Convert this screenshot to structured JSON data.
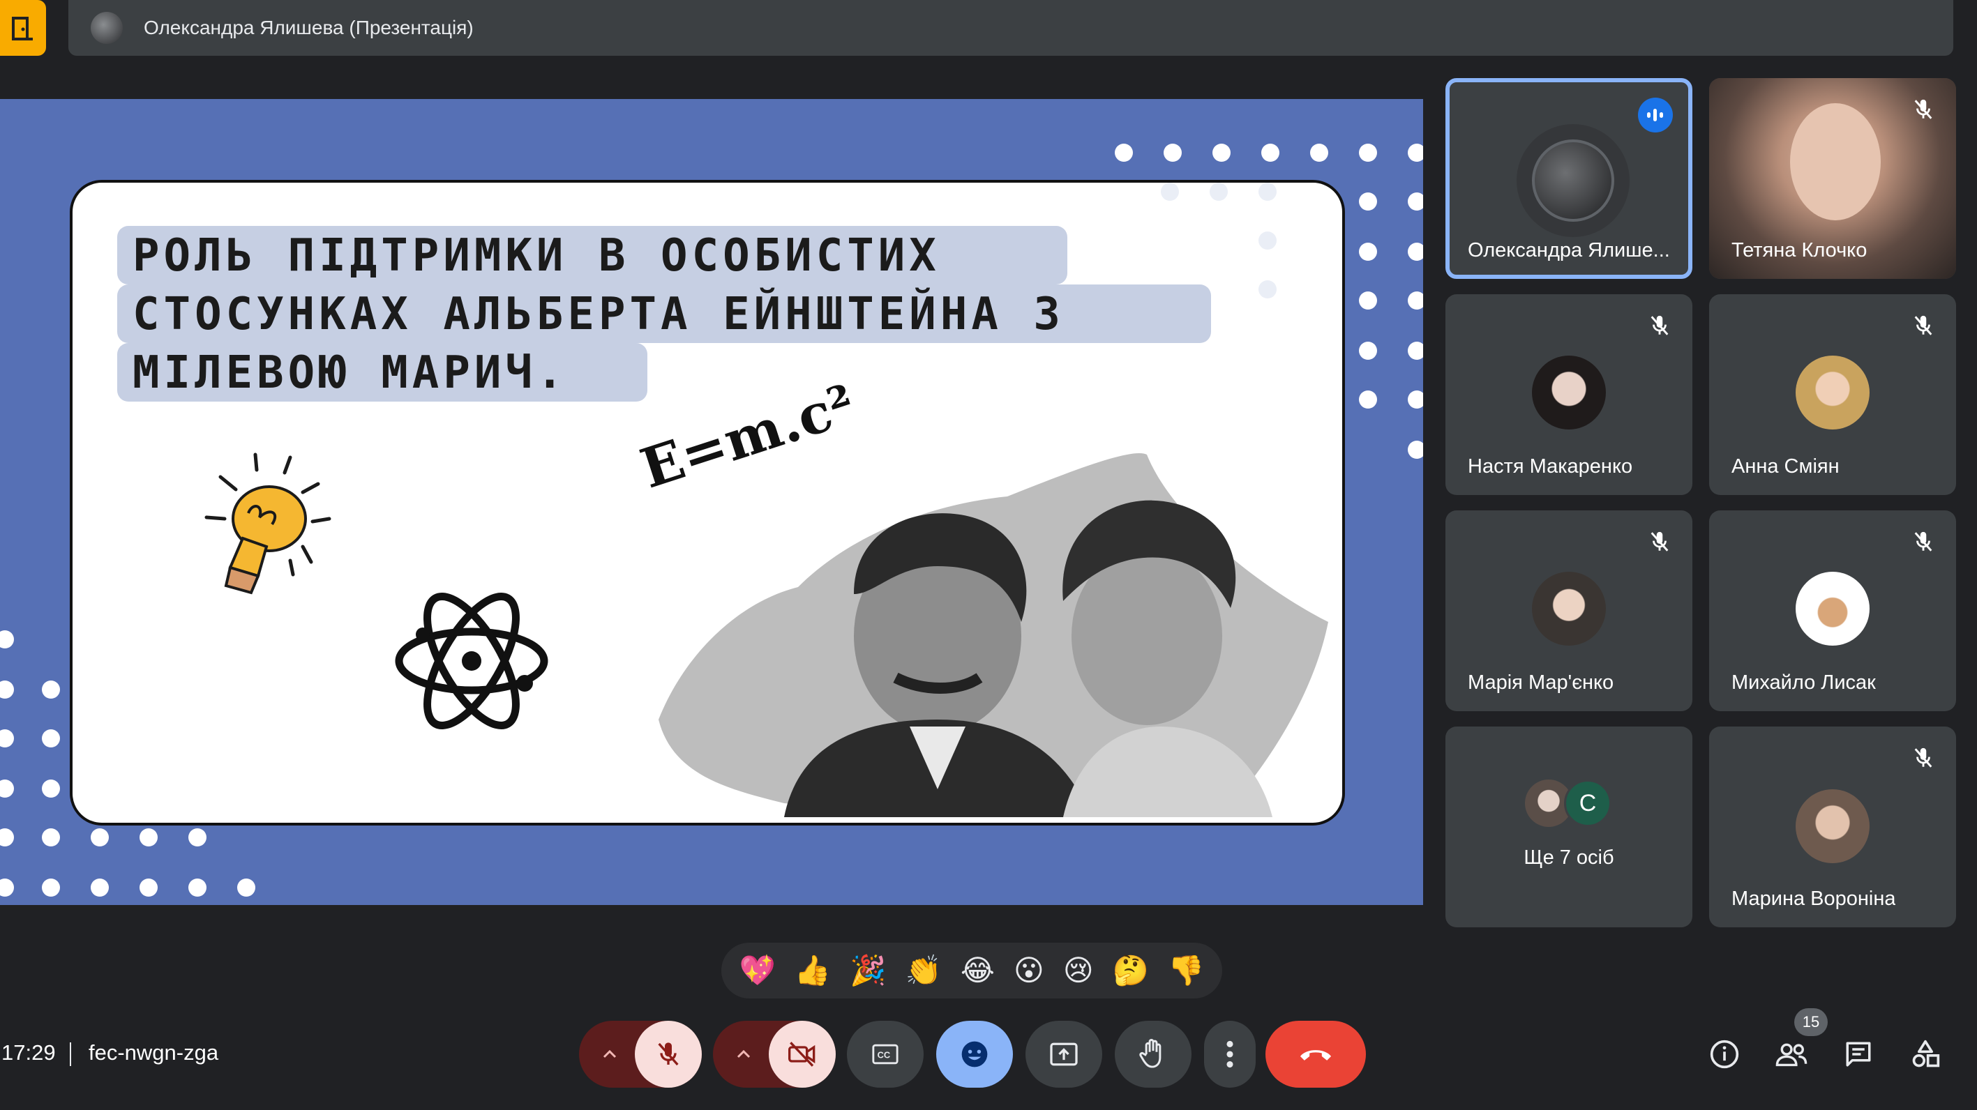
{
  "header": {
    "presenter_label": "Олександра Ялишева (Презентація)"
  },
  "slide": {
    "title_lines": [
      "РОЛЬ ПІДТРИМКИ В ОСОБИСТИХ",
      "СТОСУНКАХ АЛЬБЕРТА ЕЙНШТЕЙНА З",
      "МІЛЕВОЮ МАРИЧ."
    ],
    "formula": "E=m.c²",
    "photo_alt": "portrait of Albert Einstein and Mileva Marić"
  },
  "participants": [
    {
      "name": "Олександра Ялише...",
      "speaking": true
    },
    {
      "name": "Тетяна Клочко",
      "muted": true
    },
    {
      "name": "Настя Макаренко",
      "muted": true
    },
    {
      "name": "Анна Сміян",
      "muted": true
    },
    {
      "name": "Марія Мар'єнко",
      "muted": true
    },
    {
      "name": "Михайло Лисак",
      "muted": true
    },
    {
      "name": "Ще 7 осіб",
      "initial": "C"
    },
    {
      "name": "Марина Вороніна",
      "muted": true
    }
  ],
  "reactions": [
    "💖",
    "👍",
    "🎉",
    "👏",
    "😂",
    "😮",
    "😢",
    "🤔",
    "👎"
  ],
  "footer": {
    "time": "17:29",
    "meeting_code": "fec-nwgn-zga",
    "people_count": "15"
  },
  "colors": {
    "background": "#202124",
    "tile": "#3c4043",
    "slide_blue": "#5670b5",
    "accent_blue": "#8ab4f8",
    "danger": "#ea4335",
    "muted_red_bg": "#f9dedc"
  }
}
